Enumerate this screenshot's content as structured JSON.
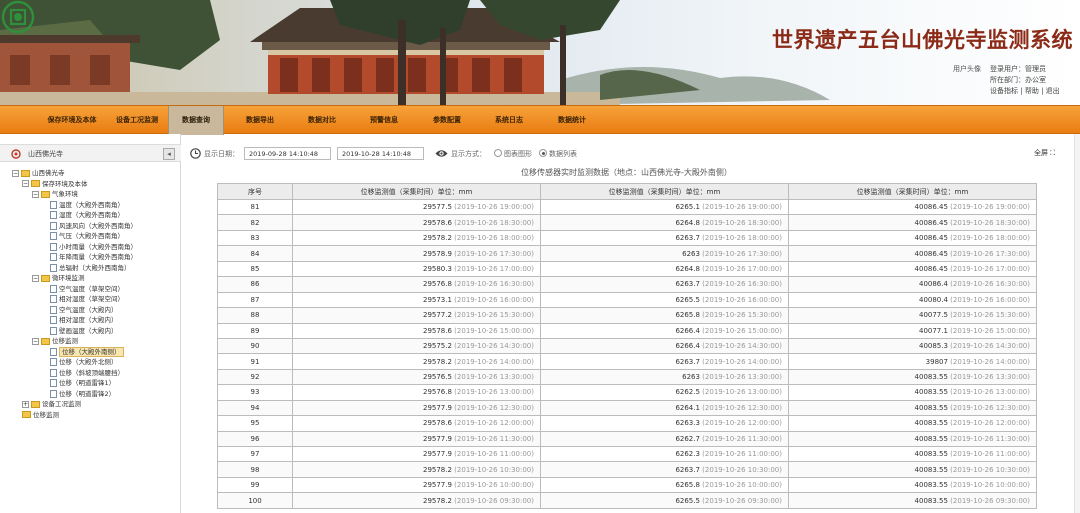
{
  "header": {
    "title": "世界遗产五台山佛光寺监测系统",
    "logo_text": "",
    "avatar_alt": "用户头像",
    "user_label": "登录用户：管理员",
    "dept_label": "所在部门：办公室",
    "links": [
      "设备指标",
      "帮助",
      "退出"
    ]
  },
  "nav": {
    "items": [
      "保存环境及本体",
      "设备工况监测",
      "数据查询",
      "数据导出",
      "数据对比",
      "预警信息",
      "参数配置",
      "系统日志",
      "数据统计"
    ],
    "active_index": 2
  },
  "sidebar": {
    "title": "山西佛光寺",
    "collapse_glyph": "◂",
    "tree": [
      {
        "label": "山西佛光寺",
        "type": "folder",
        "toggle": "−",
        "level": 0
      },
      {
        "label": "保存环境及本体",
        "type": "folder",
        "toggle": "−",
        "level": 1
      },
      {
        "label": "气象环境",
        "type": "folder",
        "toggle": "−",
        "level": 2
      },
      {
        "label": "温度（大殿外西南角）",
        "type": "file",
        "level": 3
      },
      {
        "label": "湿度（大殿外西南角）",
        "type": "file",
        "level": 3
      },
      {
        "label": "风速风向（大殿外西南角）",
        "type": "file",
        "level": 3
      },
      {
        "label": "气压（大殿外西南角）",
        "type": "file",
        "level": 3
      },
      {
        "label": "小时雨量（大殿外西南角）",
        "type": "file",
        "level": 3
      },
      {
        "label": "年降雨量（大殿外西南角）",
        "type": "file",
        "level": 3
      },
      {
        "label": "总辐射（大殿外西南角）",
        "type": "file",
        "level": 3
      },
      {
        "label": "微环境监测",
        "type": "folder",
        "toggle": "−",
        "level": 2
      },
      {
        "label": "空气温度（草架空间）",
        "type": "file",
        "level": 3
      },
      {
        "label": "相对湿度（草架空间）",
        "type": "file",
        "level": 3
      },
      {
        "label": "空气温度（大殿内）",
        "type": "file",
        "level": 3
      },
      {
        "label": "相对湿度（大殿内）",
        "type": "file",
        "level": 3
      },
      {
        "label": "壁画温度（大殿内）",
        "type": "file",
        "level": 3
      },
      {
        "label": "位移监测",
        "type": "folder",
        "toggle": "−",
        "level": 2
      },
      {
        "label": "位移（大殿外南侧）",
        "type": "file",
        "level": 3,
        "selected": true
      },
      {
        "label": "位移（大殿外北侧）",
        "type": "file",
        "level": 3
      },
      {
        "label": "位移（斜坡顶端腰挡）",
        "type": "file",
        "level": 3
      },
      {
        "label": "位移（明道雷锋1）",
        "type": "file",
        "level": 3
      },
      {
        "label": "位移（明道雷锋2）",
        "type": "file",
        "level": 3
      },
      {
        "label": "设备工况监测",
        "type": "folder",
        "toggle": "+",
        "level": 1
      },
      {
        "label": "位移监测",
        "type": "folder",
        "level": 1
      }
    ]
  },
  "toolbar": {
    "date_label": "显示日期：",
    "start_date": "2019-09-28 14:10:48",
    "end_date": "2019-10-28 14:10:48",
    "mode_label": "显示方式：",
    "mode_options": [
      "图表图形",
      "数据列表"
    ],
    "mode_selected": 1,
    "fullscreen_label": "全屏"
  },
  "table": {
    "caption": "位移传感器实时监测数据（地点：山西佛光寺-大殿外南侧）",
    "headers": [
      "序号",
      "位移监测值（采集时间）单位：mm",
      "位移监测值（采集时间）单位：mm",
      "位移监测值（采集时间）单位：mm"
    ],
    "rows": [
      {
        "n": "81",
        "a": "29577.5",
        "at": "2019-10-26 19:00:00",
        "b": "6265.1",
        "bt": "2019-10-26 19:00:00",
        "c": "40086.45",
        "ct": "2019-10-26 19:00:00"
      },
      {
        "n": "82",
        "a": "29578.6",
        "at": "2019-10-26 18:30:00",
        "b": "6264.8",
        "bt": "2019-10-26 18:30:00",
        "c": "40086.45",
        "ct": "2019-10-26 18:30:00"
      },
      {
        "n": "83",
        "a": "29578.2",
        "at": "2019-10-26 18:00:00",
        "b": "6263.7",
        "bt": "2019-10-26 18:00:00",
        "c": "40086.45",
        "ct": "2019-10-26 18:00:00"
      },
      {
        "n": "84",
        "a": "29578.9",
        "at": "2019-10-26 17:30:00",
        "b": "6263",
        "bt": "2019-10-26 17:30:00",
        "c": "40086.45",
        "ct": "2019-10-26 17:30:00"
      },
      {
        "n": "85",
        "a": "29580.3",
        "at": "2019-10-26 17:00:00",
        "b": "6264.8",
        "bt": "2019-10-26 17:00:00",
        "c": "40086.45",
        "ct": "2019-10-26 17:00:00"
      },
      {
        "n": "86",
        "a": "29576.8",
        "at": "2019-10-26 16:30:00",
        "b": "6263.7",
        "bt": "2019-10-26 16:30:00",
        "c": "40086.4",
        "ct": "2019-10-26 16:30:00"
      },
      {
        "n": "87",
        "a": "29573.1",
        "at": "2019-10-26 16:00:00",
        "b": "6265.5",
        "bt": "2019-10-26 16:00:00",
        "c": "40080.4",
        "ct": "2019-10-26 16:00:00"
      },
      {
        "n": "88",
        "a": "29577.2",
        "at": "2019-10-26 15:30:00",
        "b": "6265.8",
        "bt": "2019-10-26 15:30:00",
        "c": "40077.5",
        "ct": "2019-10-26 15:30:00"
      },
      {
        "n": "89",
        "a": "29578.6",
        "at": "2019-10-26 15:00:00",
        "b": "6266.4",
        "bt": "2019-10-26 15:00:00",
        "c": "40077.1",
        "ct": "2019-10-26 15:00:00"
      },
      {
        "n": "90",
        "a": "29575.2",
        "at": "2019-10-26 14:30:00",
        "b": "6266.4",
        "bt": "2019-10-26 14:30:00",
        "c": "40085.3",
        "ct": "2019-10-26 14:30:00"
      },
      {
        "n": "91",
        "a": "29578.2",
        "at": "2019-10-26 14:00:00",
        "b": "6263.7",
        "bt": "2019-10-26 14:00:00",
        "c": "39807",
        "ct": "2019-10-26 14:00:00"
      },
      {
        "n": "92",
        "a": "29576.5",
        "at": "2019-10-26 13:30:00",
        "b": "6263",
        "bt": "2019-10-26 13:30:00",
        "c": "40083.55",
        "ct": "2019-10-26 13:30:00"
      },
      {
        "n": "93",
        "a": "29576.8",
        "at": "2019-10-26 13:00:00",
        "b": "6262.5",
        "bt": "2019-10-26 13:00:00",
        "c": "40083.55",
        "ct": "2019-10-26 13:00:00"
      },
      {
        "n": "94",
        "a": "29577.9",
        "at": "2019-10-26 12:30:00",
        "b": "6264.1",
        "bt": "2019-10-26 12:30:00",
        "c": "40083.55",
        "ct": "2019-10-26 12:30:00"
      },
      {
        "n": "95",
        "a": "29578.6",
        "at": "2019-10-26 12:00:00",
        "b": "6263.3",
        "bt": "2019-10-26 12:00:00",
        "c": "40083.55",
        "ct": "2019-10-26 12:00:00"
      },
      {
        "n": "96",
        "a": "29577.9",
        "at": "2019-10-26 11:30:00",
        "b": "6262.7",
        "bt": "2019-10-26 11:30:00",
        "c": "40083.55",
        "ct": "2019-10-26 11:30:00"
      },
      {
        "n": "97",
        "a": "29577.9",
        "at": "2019-10-26 11:00:00",
        "b": "6262.3",
        "bt": "2019-10-26 11:00:00",
        "c": "40083.55",
        "ct": "2019-10-26 11:00:00"
      },
      {
        "n": "98",
        "a": "29578.2",
        "at": "2019-10-26 10:30:00",
        "b": "6263.7",
        "bt": "2019-10-26 10:30:00",
        "c": "40083.55",
        "ct": "2019-10-26 10:30:00"
      },
      {
        "n": "99",
        "a": "29577.9",
        "at": "2019-10-26 10:00:00",
        "b": "6265.8",
        "bt": "2019-10-26 10:00:00",
        "c": "40083.55",
        "ct": "2019-10-26 10:00:00"
      },
      {
        "n": "100",
        "a": "29578.2",
        "at": "2019-10-26 09:30:00",
        "b": "6265.5",
        "bt": "2019-10-26 09:30:00",
        "c": "40083.55",
        "ct": "2019-10-26 09:30:00"
      }
    ]
  },
  "colors": {
    "nav_orange": "#ef8a1c",
    "title_red": "#8c2a18",
    "logo_green": "#2f8f3a"
  }
}
